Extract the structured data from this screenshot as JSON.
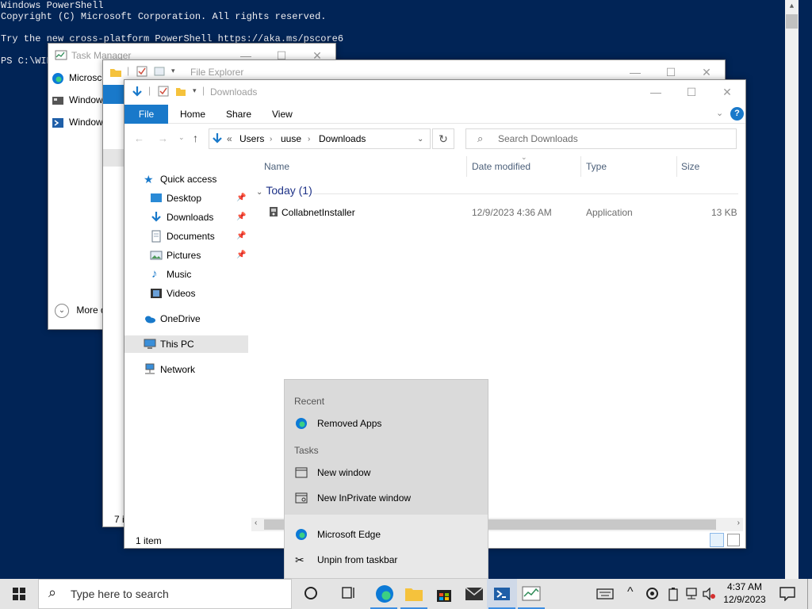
{
  "powershell": {
    "lines": [
      "Windows PowerShell",
      "Copyright (C) Microsoft Corporation. All rights reserved.",
      "",
      "Try the new cross-platform PowerShell https://aka.ms/pscore6",
      "",
      "PS C:\\WIN"
    ]
  },
  "task_manager": {
    "title": "Task Manager",
    "rows": [
      "Microsc",
      "Window",
      "Window"
    ],
    "more": "More d"
  },
  "file_explorer_back": {
    "title": "File Explorer",
    "status": "7 i"
  },
  "explorer": {
    "title": "Downloads",
    "tabs": [
      "File",
      "Home",
      "Share",
      "View"
    ],
    "breadcrumb": [
      "Users",
      "uuse",
      "Downloads"
    ],
    "search_placeholder": "Search Downloads",
    "columns": [
      "Name",
      "Date modified",
      "Type",
      "Size"
    ],
    "group": "Today (1)",
    "files": [
      {
        "name": "CollabnetInstaller",
        "date": "12/9/2023 4:36 AM",
        "type": "Application",
        "size": "13 KB"
      }
    ],
    "nav": {
      "quick_access": "Quick access",
      "items": [
        "Desktop",
        "Downloads",
        "Documents",
        "Pictures",
        "Music",
        "Videos"
      ],
      "onedrive": "OneDrive",
      "this_pc": "This PC",
      "network": "Network"
    },
    "status": "1 item"
  },
  "jump_list": {
    "recent_header": "Recent",
    "recent": [
      "Removed Apps"
    ],
    "tasks_header": "Tasks",
    "tasks": [
      "New window",
      "New InPrivate window"
    ],
    "app": "Microsoft Edge",
    "unpin": "Unpin from taskbar"
  },
  "taskbar": {
    "search_placeholder": "Type here to search",
    "time": "4:37 AM",
    "date": "12/9/2023"
  },
  "colors": {
    "powershell_bg": "#012456",
    "accent": "#1979ca"
  }
}
